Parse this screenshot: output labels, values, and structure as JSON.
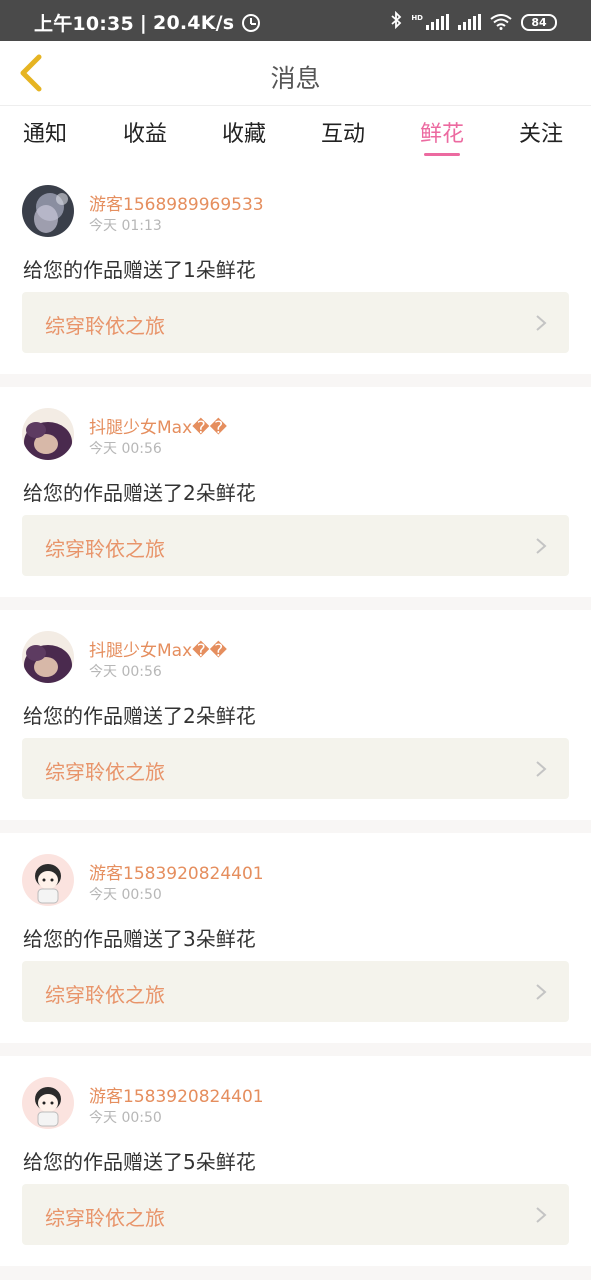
{
  "status_bar": {
    "time": "上午10:35",
    "network_speed": "20.4K/s",
    "hd_label": "HD",
    "battery": "84",
    "icons": [
      "alarm-icon",
      "bluetooth-icon",
      "signal-icon",
      "wifi-icon",
      "battery-icon"
    ]
  },
  "header": {
    "title": "消息",
    "back_icon": "chevron-left-icon"
  },
  "tabs": [
    {
      "label": "通知"
    },
    {
      "label": "收益"
    },
    {
      "label": "收藏"
    },
    {
      "label": "互动"
    },
    {
      "label": "鲜花",
      "active": true
    },
    {
      "label": "关注"
    }
  ],
  "theme": {
    "accent": "#ec6aa0",
    "username_color": "#e58e5e",
    "work_color": "#e8946a",
    "status_bar_bg": "#4a4a4a",
    "back_icon_color": "#e6b422"
  },
  "messages": [
    {
      "user": "游客1568989969533",
      "time": "今天 01:13",
      "text": "给您的作品赠送了1朵鲜花",
      "work": "综穿聆依之旅",
      "avatar": "avatar-image"
    },
    {
      "user": "抖腿少女Max��",
      "time": "今天 00:56",
      "text": "给您的作品赠送了2朵鲜花",
      "work": "综穿聆依之旅",
      "avatar": "avatar-image"
    },
    {
      "user": "抖腿少女Max��",
      "time": "今天 00:56",
      "text": "给您的作品赠送了2朵鲜花",
      "work": "综穿聆依之旅",
      "avatar": "avatar-image"
    },
    {
      "user": "游客1583920824401",
      "time": "今天 00:50",
      "text": "给您的作品赠送了3朵鲜花",
      "work": "综穿聆依之旅",
      "avatar": "avatar-image"
    },
    {
      "user": "游客1583920824401",
      "time": "今天 00:50",
      "text": "给您的作品赠送了5朵鲜花",
      "work": "综穿聆依之旅",
      "avatar": "avatar-image"
    }
  ]
}
